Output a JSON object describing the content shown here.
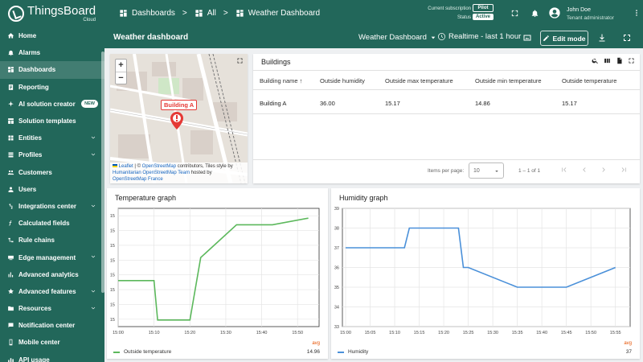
{
  "brand": {
    "name": "ThingsBoard",
    "sub": "Cloud"
  },
  "sidebar": {
    "items": [
      {
        "label": "Home",
        "icon": "home-icon"
      },
      {
        "label": "Alarms",
        "icon": "bell-icon"
      },
      {
        "label": "Dashboards",
        "icon": "dashboard-icon",
        "active": true
      },
      {
        "label": "Reporting",
        "icon": "report-icon"
      },
      {
        "label": "AI solution creator",
        "icon": "sparkle-icon",
        "badge": "NEW"
      },
      {
        "label": "Solution templates",
        "icon": "template-icon"
      },
      {
        "label": "Entities",
        "icon": "entities-icon",
        "expandable": true
      },
      {
        "label": "Profiles",
        "icon": "profiles-icon",
        "expandable": true
      },
      {
        "label": "Customers",
        "icon": "customers-icon"
      },
      {
        "label": "Users",
        "icon": "user-icon"
      },
      {
        "label": "Integrations center",
        "icon": "integration-icon",
        "expandable": true
      },
      {
        "label": "Calculated fields",
        "icon": "function-icon"
      },
      {
        "label": "Rule chains",
        "icon": "rule-chain-icon"
      },
      {
        "label": "Edge management",
        "icon": "edge-icon",
        "expandable": true
      },
      {
        "label": "Advanced analytics",
        "icon": "analytics-icon"
      },
      {
        "label": "Advanced features",
        "icon": "features-icon",
        "expandable": true
      },
      {
        "label": "Resources",
        "icon": "folder-icon",
        "expandable": true
      },
      {
        "label": "Notification center",
        "icon": "notification-icon"
      },
      {
        "label": "Mobile center",
        "icon": "mobile-icon"
      },
      {
        "label": "API usage",
        "icon": "api-icon"
      }
    ]
  },
  "header": {
    "breadcrumb": [
      {
        "label": "Dashboards"
      },
      {
        "label": "All"
      },
      {
        "label": "Weather Dashboard"
      }
    ],
    "subscription_label": "Current subscription",
    "status_label": "Status",
    "plan": "Pilot",
    "status": "Active",
    "user_name": "John Doe",
    "user_role": "Tenant administrator"
  },
  "dashboard": {
    "title": "Weather dashboard",
    "selector": "Weather Dashboard",
    "timewindow": "Realtime - last 1 hour",
    "edit_label": "Edit mode"
  },
  "map": {
    "marker_label": "Building A",
    "attribution": {
      "leaflet": "Leaflet",
      "sep1": " | © ",
      "osm": "OpenStreetMap",
      "text1": " contributors, Tiles style by ",
      "hot": "Humanitarian OpenStreetMap Team",
      "text2": " hosted by ",
      "osmfr": "OpenStreetMap France"
    }
  },
  "buildings": {
    "title": "Buildings",
    "columns": [
      "Building name",
      "Outside humidity",
      "Outside max temperature",
      "Outside min temperature",
      "Outside temperature"
    ],
    "rows": [
      [
        "Building A",
        "36.00",
        "15.17",
        "14.86",
        "15.17"
      ]
    ],
    "pager": {
      "label": "Items per page:",
      "page_size": "10",
      "range": "1 – 1 of 1"
    }
  },
  "charts": {
    "temperature": {
      "title": "Temperature graph",
      "legend": "Outside temperature",
      "avg_label": "avg",
      "avg_value": "14.96",
      "color": "#5cb85c"
    },
    "humidity": {
      "title": "Humidity graph",
      "legend": "Humidity",
      "avg_label": "avg",
      "avg_value": "37",
      "color": "#4a90d9"
    }
  },
  "chart_data": [
    {
      "type": "line",
      "title": "Temperature graph",
      "x": [
        "15:00",
        "15:10",
        "15:11",
        "15:20",
        "15:23",
        "15:33",
        "15:43",
        "15:53"
      ],
      "xticks": [
        "15:00",
        "15:10",
        "15:20",
        "15:30",
        "15:40",
        "15:50"
      ],
      "yticks": [
        "15",
        "15",
        "15",
        "15",
        "15",
        "15",
        "15",
        "15"
      ],
      "series": [
        {
          "name": "Outside temperature",
          "values": [
            14.98,
            14.98,
            14.86,
            14.86,
            15.05,
            15.15,
            15.15,
            15.17
          ]
        }
      ],
      "ylim": [
        14.84,
        15.2
      ]
    },
    {
      "type": "line",
      "title": "Humidity graph",
      "x": [
        "15:00",
        "15:12",
        "15:13",
        "15:23",
        "15:24",
        "15:25",
        "15:35",
        "15:45",
        "15:55"
      ],
      "xticks": [
        "15:00",
        "15:05",
        "15:10",
        "15:15",
        "15:20",
        "15:25",
        "15:30",
        "15:35",
        "15:40",
        "15:45",
        "15:50",
        "15:55"
      ],
      "yticks": [
        33,
        34,
        35,
        36,
        37,
        38,
        39
      ],
      "series": [
        {
          "name": "Humidity",
          "values": [
            37,
            37,
            38,
            38,
            36,
            36,
            35,
            35,
            36
          ]
        }
      ],
      "ylim": [
        33,
        39
      ]
    }
  ]
}
